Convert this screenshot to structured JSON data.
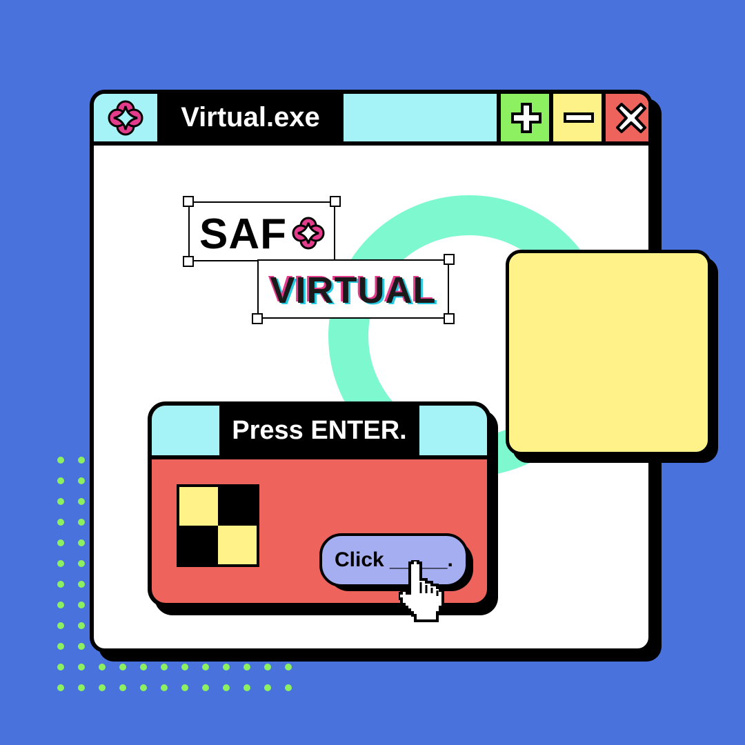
{
  "window": {
    "title": "Virtual.exe",
    "controls": {
      "maximize_icon": "plus-icon",
      "minimize_icon": "minus-icon",
      "close_icon": "close-x-icon"
    }
  },
  "canvas": {
    "brand_text": "SAF",
    "brand_icon": "flower-star-icon",
    "headline": "VIRTUAL"
  },
  "dialog": {
    "title": "Press ENTER.",
    "button_label": "Click _____."
  },
  "colors": {
    "background": "#4a72dc",
    "titlebar": "#a5f3f6",
    "plus": "#8df061",
    "minus": "#fdf287",
    "close": "#ee635b",
    "ring": "#7ef8cf",
    "panel": "#fef288",
    "dialog": "#ee635b",
    "button": "#a4aef0",
    "magenta": "#e43c8d",
    "dots": "#8df061"
  }
}
